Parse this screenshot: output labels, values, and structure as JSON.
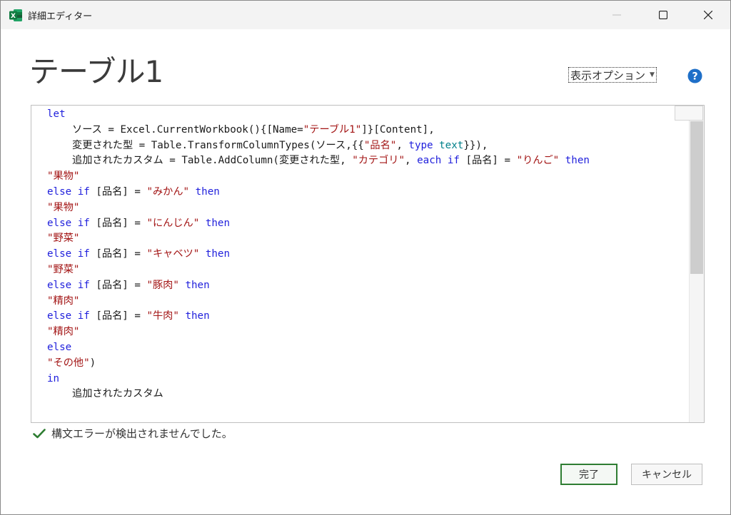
{
  "window": {
    "title": "詳細エディター",
    "app_icon_letter": "X",
    "accent_color": "#1d6f42"
  },
  "page_title": "テーブル1",
  "toolbar": {
    "view_options_label": "表示オプション",
    "caret": "▼"
  },
  "editor": {
    "lines": [
      {
        "indent": false,
        "tokens": [
          {
            "t": "let",
            "c": "kw"
          }
        ]
      },
      {
        "indent": true,
        "tokens": [
          {
            "t": "ソース = Excel.CurrentWorkbook(){[Name=",
            "c": ""
          },
          {
            "t": "\"テーブル1\"",
            "c": "str"
          },
          {
            "t": "]}[Content],",
            "c": ""
          }
        ]
      },
      {
        "indent": true,
        "tokens": [
          {
            "t": "変更された型 = Table.TransformColumnTypes(ソース,{{",
            "c": ""
          },
          {
            "t": "\"品名\"",
            "c": "str"
          },
          {
            "t": ", ",
            "c": ""
          },
          {
            "t": "type",
            "c": "kw"
          },
          {
            "t": " ",
            "c": ""
          },
          {
            "t": "text",
            "c": "typ"
          },
          {
            "t": "}}),",
            "c": ""
          }
        ]
      },
      {
        "indent": true,
        "tokens": [
          {
            "t": "追加されたカスタム = Table.AddColumn(変更された型, ",
            "c": ""
          },
          {
            "t": "\"カテゴリ\"",
            "c": "str"
          },
          {
            "t": ", ",
            "c": ""
          },
          {
            "t": "each",
            "c": "kw"
          },
          {
            "t": " ",
            "c": ""
          },
          {
            "t": "if",
            "c": "kw"
          },
          {
            "t": " [品名] = ",
            "c": ""
          },
          {
            "t": "\"りんご\"",
            "c": "str"
          },
          {
            "t": " ",
            "c": ""
          },
          {
            "t": "then",
            "c": "kw"
          }
        ]
      },
      {
        "indent": false,
        "tokens": [
          {
            "t": "\"果物\"",
            "c": "str"
          }
        ]
      },
      {
        "indent": false,
        "tokens": [
          {
            "t": "else",
            "c": "kw"
          },
          {
            "t": " ",
            "c": ""
          },
          {
            "t": "if",
            "c": "kw"
          },
          {
            "t": " [品名] = ",
            "c": ""
          },
          {
            "t": "\"みかん\"",
            "c": "str"
          },
          {
            "t": " ",
            "c": ""
          },
          {
            "t": "then",
            "c": "kw"
          }
        ]
      },
      {
        "indent": false,
        "tokens": [
          {
            "t": "\"果物\"",
            "c": "str"
          }
        ]
      },
      {
        "indent": false,
        "tokens": [
          {
            "t": "else",
            "c": "kw"
          },
          {
            "t": " ",
            "c": ""
          },
          {
            "t": "if",
            "c": "kw"
          },
          {
            "t": " [品名] = ",
            "c": ""
          },
          {
            "t": "\"にんじん\"",
            "c": "str"
          },
          {
            "t": " ",
            "c": ""
          },
          {
            "t": "then",
            "c": "kw"
          }
        ]
      },
      {
        "indent": false,
        "tokens": [
          {
            "t": "\"野菜\"",
            "c": "str"
          }
        ]
      },
      {
        "indent": false,
        "tokens": [
          {
            "t": "else",
            "c": "kw"
          },
          {
            "t": " ",
            "c": ""
          },
          {
            "t": "if",
            "c": "kw"
          },
          {
            "t": " [品名] = ",
            "c": ""
          },
          {
            "t": "\"キャベツ\"",
            "c": "str"
          },
          {
            "t": " ",
            "c": ""
          },
          {
            "t": "then",
            "c": "kw"
          }
        ]
      },
      {
        "indent": false,
        "tokens": [
          {
            "t": "\"野菜\"",
            "c": "str"
          }
        ]
      },
      {
        "indent": false,
        "tokens": [
          {
            "t": "else",
            "c": "kw"
          },
          {
            "t": " ",
            "c": ""
          },
          {
            "t": "if",
            "c": "kw"
          },
          {
            "t": " [品名] = ",
            "c": ""
          },
          {
            "t": "\"豚肉\"",
            "c": "str"
          },
          {
            "t": " ",
            "c": ""
          },
          {
            "t": "then",
            "c": "kw"
          }
        ]
      },
      {
        "indent": false,
        "tokens": [
          {
            "t": "\"精肉\"",
            "c": "str"
          }
        ]
      },
      {
        "indent": false,
        "tokens": [
          {
            "t": "else",
            "c": "kw"
          },
          {
            "t": " ",
            "c": ""
          },
          {
            "t": "if",
            "c": "kw"
          },
          {
            "t": " [品名] = ",
            "c": ""
          },
          {
            "t": "\"牛肉\"",
            "c": "str"
          },
          {
            "t": " ",
            "c": ""
          },
          {
            "t": "then",
            "c": "kw"
          }
        ]
      },
      {
        "indent": false,
        "tokens": [
          {
            "t": "\"精肉\"",
            "c": "str"
          }
        ]
      },
      {
        "indent": false,
        "tokens": [
          {
            "t": "else",
            "c": "kw"
          }
        ]
      },
      {
        "indent": false,
        "tokens": [
          {
            "t": "\"その他\"",
            "c": "str"
          },
          {
            "t": ")",
            "c": ""
          }
        ]
      },
      {
        "indent": false,
        "tokens": [
          {
            "t": "in",
            "c": "kw"
          }
        ]
      },
      {
        "indent": true,
        "tokens": [
          {
            "t": "追加されたカスタム",
            "c": ""
          }
        ]
      }
    ]
  },
  "status": {
    "message": "構文エラーが検出されませんでした。",
    "color": "#2e7d32"
  },
  "buttons": {
    "done_label": "完了",
    "cancel_label": "キャンセル"
  }
}
